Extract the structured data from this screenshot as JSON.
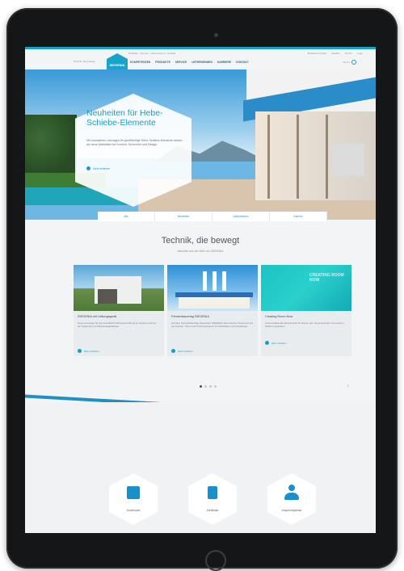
{
  "site": {
    "utility_left": "Produkte · Service · Unternehmen · Kontakt",
    "utility_right": [
      "Business Kunden",
      "Händler",
      "Termin",
      "Login"
    ],
    "claim": "Technik, die bewegt",
    "logo_text": "SIEGENIA",
    "nav": [
      "KOMPETENZEN",
      "PRODUKTE",
      "SERVICE",
      "UNTERNEHMEN",
      "KARRIERE",
      "KONTAKT"
    ],
    "search_label": "Suche",
    "accent_color": "#1b9cc3"
  },
  "hero": {
    "title": "Neuheiten für Hebe-Schiebe-Elemente",
    "text": "Mit innovativen Lösungen für großflächige Hebe-Schiebe-Elemente setzen wir neue Maßstäbe bei Komfort, Sicherheit und Design.",
    "more_label": "Mehr erfahren"
  },
  "tabs": [
    "Alle",
    "Neuheiten",
    "Unternehmen",
    "Karriere"
  ],
  "section": {
    "title": "Technik, die bewegt",
    "subtitle": "Aktuelles aus der Welt von SIEGENIA"
  },
  "cards": [
    {
      "title": "SIEGENIA mit Lüftungsgerät",
      "text": "Neue Lösungen für die kontrollierte Wohnraumlüftung im Neubau und bei der Sanierung von Bestandsgebäuden.",
      "more": "Mehr erfahren"
    },
    {
      "title": "Fensterbauertag SIEGENIA",
      "text": "Auf dem Fensterbauertag präsentiert SIEGENIA die neuesten Systeme rund um Fenster, Türen und Komfortsysteme für Architekten und Verarbeiter.",
      "more": "Mehr erfahren"
    },
    {
      "title": "Creating Room Now",
      "text": "Unsere Markenbotschaft steht für Raum, den wir gemeinsam mit unseren Partnern gestalten.",
      "more": "Mehr erfahren",
      "image_text": "CREATING ROOM NOW"
    }
  ],
  "quick_links": [
    {
      "label": "Downloads",
      "icon": "download-icon"
    },
    {
      "label": "Zertifikate",
      "icon": "document-icon"
    },
    {
      "label": "Ansprechpartner",
      "icon": "person-icon"
    }
  ]
}
